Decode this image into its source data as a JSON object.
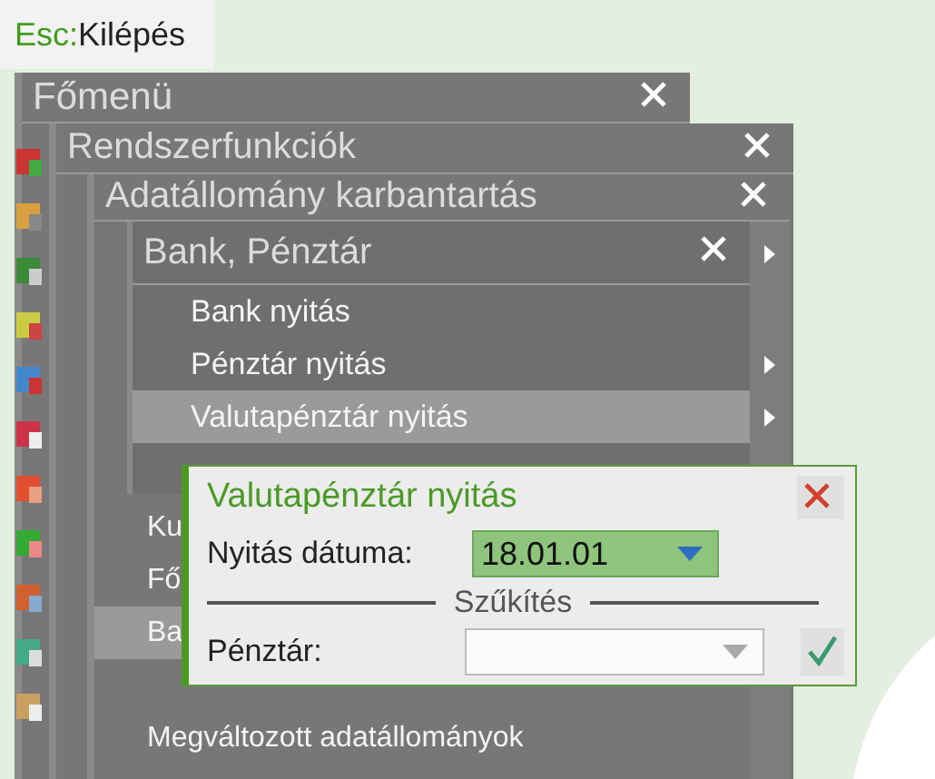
{
  "top_bar": {
    "key": "Esc:",
    "label": "Kilépés"
  },
  "menus": [
    {
      "title": "Főmenü"
    },
    {
      "title": "Rendszerfunkciók"
    },
    {
      "title": "Adatállomány karbantartás",
      "items": [
        {
          "label": "Ku",
          "selected": false
        },
        {
          "label": "Fő",
          "selected": false
        },
        {
          "label": "Ba",
          "selected": true
        },
        {
          "label": "Megváltozott adatállományok",
          "selected": false
        }
      ]
    },
    {
      "title": "Bank, Pénztár",
      "submenu": true,
      "items": [
        {
          "label": "Bank nyitás",
          "selected": false,
          "submenu": false
        },
        {
          "label": "Pénztár nyitás",
          "selected": false,
          "submenu": true
        },
        {
          "label": "Valutapénztár nyitás",
          "selected": true,
          "submenu": true
        }
      ]
    }
  ],
  "dialog": {
    "title": "Valutapénztár nyitás",
    "date_label": "Nyitás dátuma:",
    "date_value": "18.01.01",
    "section": "Szűkítés",
    "filter_label": "Pénztár:",
    "filter_disabled": true
  }
}
